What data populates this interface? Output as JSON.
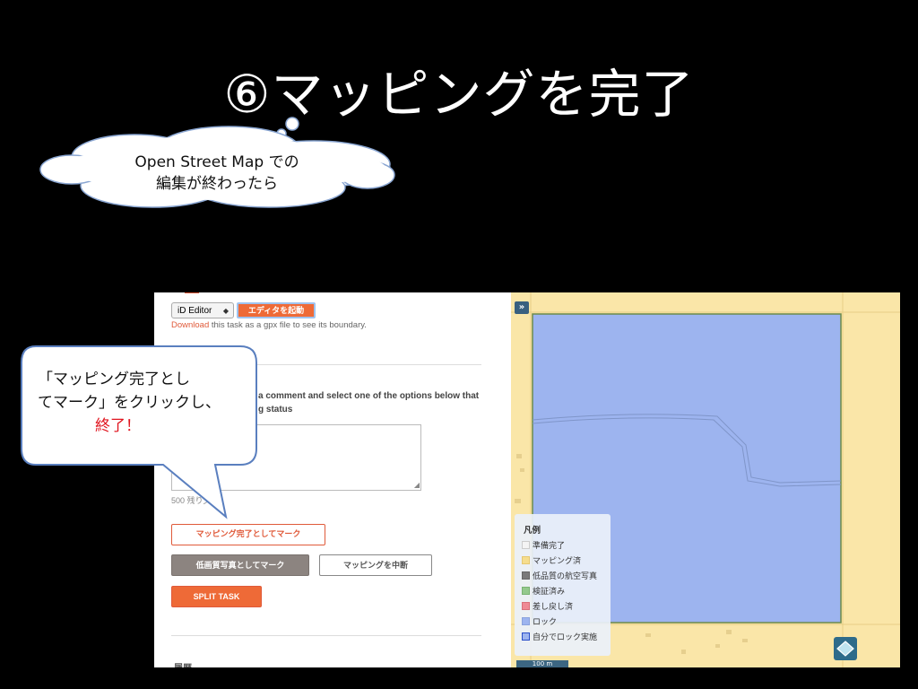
{
  "slide": {
    "title": "⑥マッピングを完了"
  },
  "cloud": {
    "line1": "Open Street Map での",
    "line2": "編集が終わったら"
  },
  "bubble": {
    "line1": "「マッピング完了とし",
    "line2": "てマーク」をクリックし、",
    "line3": "終了！"
  },
  "panel": {
    "editor_select": "iD Editor",
    "launch_button": "エディタを起動",
    "download_link": "Download",
    "download_text": " this task as a gpx file to see its boundary.",
    "instructions_line1": "a comment and select one of the options below that",
    "instructions_line2": "g status",
    "chars_left": "500 残り文",
    "mark_mapped_button": "マッピング完了としてマーク",
    "low_quality_button": "低画質写真としてマーク",
    "stop_mapping_button": "マッピングを中断",
    "split_button": "SPLIT TASK",
    "history_heading": "履歴"
  },
  "map": {
    "toggle": "»",
    "scale": "100 m",
    "legend": {
      "title": "凡例",
      "items": [
        {
          "label": "準備完了",
          "color": "#f4f4f4",
          "border": "#cccccc"
        },
        {
          "label": "マッピング済",
          "color": "#f6dd8c",
          "border": "#e6c870"
        },
        {
          "label": "低品質の航空写真",
          "color": "#7a7a7a",
          "border": "#666666"
        },
        {
          "label": "検証済み",
          "color": "#94c98c",
          "border": "#7bb373"
        },
        {
          "label": "差し戻し済",
          "color": "#ef8a94",
          "border": "#d9707a"
        },
        {
          "label": "ロック",
          "color": "#9db4ef",
          "border": "#8aa2dd"
        },
        {
          "label": "自分でロック実施",
          "color": "#9db4ef",
          "border": "#2a4fc9"
        }
      ]
    }
  },
  "colors": {
    "orange": "#ee6a37",
    "locked_blue": "#9db4ef",
    "mapped_yellow": "#fae6a8"
  }
}
